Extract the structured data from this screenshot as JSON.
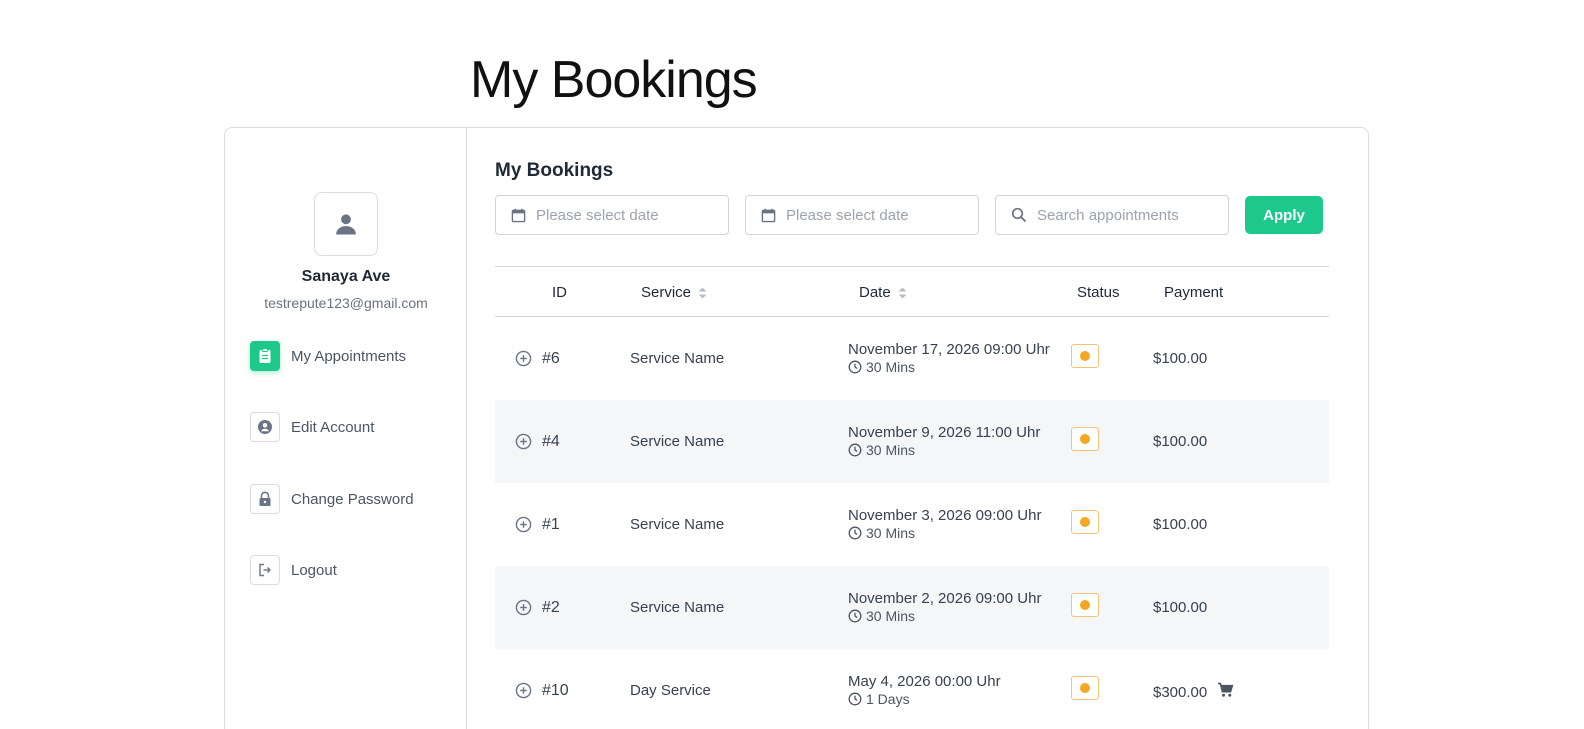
{
  "page": {
    "title": "My Bookings"
  },
  "profile": {
    "name": "Sanaya Ave",
    "email": "testrepute123@gmail.com"
  },
  "nav": [
    {
      "label": "My Appointments",
      "icon": "clipboard-icon",
      "active": true
    },
    {
      "label": "Edit Account",
      "icon": "account-circle-icon",
      "active": false
    },
    {
      "label": "Change Password",
      "icon": "lock-icon",
      "active": false
    },
    {
      "label": "Logout",
      "icon": "logout-icon",
      "active": false
    }
  ],
  "main": {
    "title": "My Bookings",
    "filters": {
      "start_date_placeholder": "Please select date",
      "end_date_placeholder": "Please select date",
      "search_placeholder": "Search appointments",
      "apply_label": "Apply"
    }
  },
  "table": {
    "headers": {
      "id": "ID",
      "service": "Service",
      "date": "Date",
      "status": "Status",
      "payment": "Payment"
    },
    "rows": [
      {
        "id": "#6",
        "service": "Service Name",
        "date": "November 17, 2026 09:00 Uhr",
        "duration": "30 Mins",
        "status_color": "#f5a623",
        "payment": "$100.00",
        "cart": false
      },
      {
        "id": "#4",
        "service": "Service Name",
        "date": "November 9, 2026 11:00 Uhr",
        "duration": "30 Mins",
        "status_color": "#f5a623",
        "payment": "$100.00",
        "cart": false
      },
      {
        "id": "#1",
        "service": "Service Name",
        "date": "November 3, 2026 09:00 Uhr",
        "duration": "30 Mins",
        "status_color": "#f5a623",
        "payment": "$100.00",
        "cart": false
      },
      {
        "id": "#2",
        "service": "Service Name",
        "date": "November 2, 2026 09:00 Uhr",
        "duration": "30 Mins",
        "status_color": "#f5a623",
        "payment": "$100.00",
        "cart": false
      },
      {
        "id": "#10",
        "service": "Day Service",
        "date": "May 4, 2026 00:00 Uhr",
        "duration": "1 Days",
        "status_color": "#f5a623",
        "payment": "$300.00",
        "cart": true
      }
    ]
  },
  "colors": {
    "accent": "#1cc88a",
    "pending": "#f5a623",
    "row_alt": "#f4f6f8"
  }
}
